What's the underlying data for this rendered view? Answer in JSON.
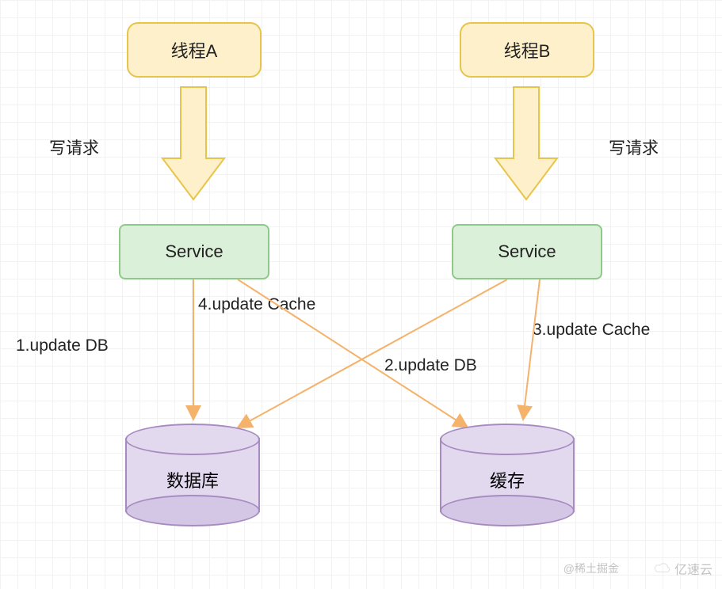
{
  "threads": {
    "a": {
      "label": "线程A"
    },
    "b": {
      "label": "线程B"
    }
  },
  "write_request_label": "写请求",
  "write_request_label_b": "写请求",
  "services": {
    "a": {
      "label": "Service"
    },
    "b": {
      "label": "Service"
    }
  },
  "storage": {
    "db": {
      "label": "数据库"
    },
    "cache": {
      "label": "缓存"
    }
  },
  "edges": {
    "step1": "1.update DB",
    "step2": "2.update DB",
    "step3": "3.update Cache",
    "step4": "4.update Cache"
  },
  "watermarks": {
    "left": "@稀土掘金",
    "right": "亿速云"
  },
  "colors": {
    "thread_fill": "#fdf0ca",
    "thread_border": "#e6c54a",
    "service_fill": "#dbf0d8",
    "service_border": "#8fc98a",
    "cylinder_fill": "#e3d9ef",
    "cylinder_border": "#a78bc0",
    "arrow": "#f5b26b"
  }
}
